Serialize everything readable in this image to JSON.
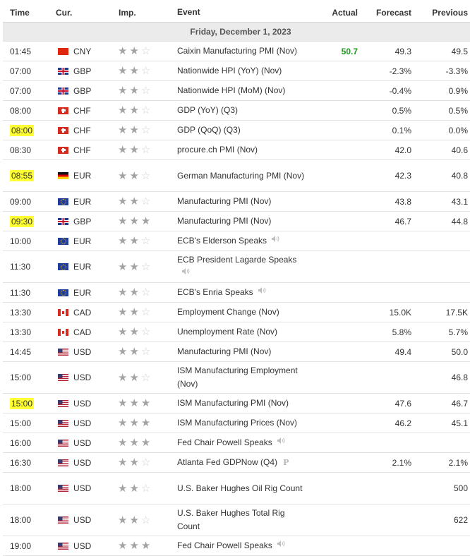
{
  "headers": {
    "time": "Time",
    "currency": "Cur.",
    "importance": "Imp.",
    "event": "Event",
    "actual": "Actual",
    "forecast": "Forecast",
    "previous": "Previous"
  },
  "date_label": "Friday, December 1, 2023",
  "colors": {
    "actual_better": "#1a9b1a",
    "highlight": "#ffff33",
    "star_on": "#a3a3a3",
    "star_off": "#d0d0d0"
  },
  "rows": [
    {
      "time": "01:45",
      "flag": "cny",
      "currency": "CNY",
      "stars": 2,
      "event": "Caixin Manufacturing PMI (Nov)",
      "actual": "50.7",
      "forecast": "49.3",
      "previous": "49.5",
      "highlight": false,
      "speaker": false,
      "prelim": false,
      "tall": false
    },
    {
      "time": "07:00",
      "flag": "gbp",
      "currency": "GBP",
      "stars": 2,
      "event": "Nationwide HPI (YoY) (Nov)",
      "actual": "",
      "forecast": "-2.3%",
      "previous": "-3.3%",
      "highlight": false,
      "speaker": false,
      "prelim": false,
      "tall": false
    },
    {
      "time": "07:00",
      "flag": "gbp",
      "currency": "GBP",
      "stars": 2,
      "event": "Nationwide HPI (MoM) (Nov)",
      "actual": "",
      "forecast": "-0.4%",
      "previous": "0.9%",
      "highlight": false,
      "speaker": false,
      "prelim": false,
      "tall": false
    },
    {
      "time": "08:00",
      "flag": "chf",
      "currency": "CHF",
      "stars": 2,
      "event": "GDP (YoY) (Q3)",
      "actual": "",
      "forecast": "0.5%",
      "previous": "0.5%",
      "highlight": false,
      "speaker": false,
      "prelim": false,
      "tall": false
    },
    {
      "time": "08:00",
      "flag": "chf",
      "currency": "CHF",
      "stars": 2,
      "event": "GDP (QoQ) (Q3)",
      "actual": "",
      "forecast": "0.1%",
      "previous": "0.0%",
      "highlight": true,
      "speaker": false,
      "prelim": false,
      "tall": false
    },
    {
      "time": "08:30",
      "flag": "chf",
      "currency": "CHF",
      "stars": 2,
      "event": "procure.ch PMI (Nov)",
      "actual": "",
      "forecast": "42.0",
      "previous": "40.6",
      "highlight": false,
      "speaker": false,
      "prelim": false,
      "tall": false
    },
    {
      "time": "08:55",
      "flag": "eur-de",
      "currency": "EUR",
      "stars": 2,
      "event": "German Manufacturing PMI (Nov)",
      "actual": "",
      "forecast": "42.3",
      "previous": "40.8",
      "highlight": true,
      "speaker": false,
      "prelim": false,
      "tall": true
    },
    {
      "time": "09:00",
      "flag": "eur",
      "currency": "EUR",
      "stars": 2,
      "event": "Manufacturing PMI (Nov)",
      "actual": "",
      "forecast": "43.8",
      "previous": "43.1",
      "highlight": false,
      "speaker": false,
      "prelim": false,
      "tall": false
    },
    {
      "time": "09:30",
      "flag": "gbp",
      "currency": "GBP",
      "stars": 3,
      "event": "Manufacturing PMI (Nov)",
      "actual": "",
      "forecast": "46.7",
      "previous": "44.8",
      "highlight": true,
      "speaker": false,
      "prelim": false,
      "tall": false
    },
    {
      "time": "10:00",
      "flag": "eur",
      "currency": "EUR",
      "stars": 2,
      "event": "ECB's Elderson Speaks",
      "actual": "",
      "forecast": "",
      "previous": "",
      "highlight": false,
      "speaker": true,
      "prelim": false,
      "tall": false
    },
    {
      "time": "11:30",
      "flag": "eur",
      "currency": "EUR",
      "stars": 2,
      "event": "ECB President Lagarde Speaks",
      "actual": "",
      "forecast": "",
      "previous": "",
      "highlight": false,
      "speaker": true,
      "prelim": false,
      "tall": true
    },
    {
      "time": "11:30",
      "flag": "eur",
      "currency": "EUR",
      "stars": 2,
      "event": "ECB's Enria Speaks",
      "actual": "",
      "forecast": "",
      "previous": "",
      "highlight": false,
      "speaker": true,
      "prelim": false,
      "tall": false
    },
    {
      "time": "13:30",
      "flag": "cad",
      "currency": "CAD",
      "stars": 2,
      "event": "Employment Change (Nov)",
      "actual": "",
      "forecast": "15.0K",
      "previous": "17.5K",
      "highlight": false,
      "speaker": false,
      "prelim": false,
      "tall": false
    },
    {
      "time": "13:30",
      "flag": "cad",
      "currency": "CAD",
      "stars": 2,
      "event": "Unemployment Rate (Nov)",
      "actual": "",
      "forecast": "5.8%",
      "previous": "5.7%",
      "highlight": false,
      "speaker": false,
      "prelim": false,
      "tall": false
    },
    {
      "time": "14:45",
      "flag": "usd",
      "currency": "USD",
      "stars": 2,
      "event": "Manufacturing PMI (Nov)",
      "actual": "",
      "forecast": "49.4",
      "previous": "50.0",
      "highlight": false,
      "speaker": false,
      "prelim": false,
      "tall": false
    },
    {
      "time": "15:00",
      "flag": "usd",
      "currency": "USD",
      "stars": 2,
      "event": "ISM Manufacturing Employment (Nov)",
      "actual": "",
      "forecast": "",
      "previous": "46.8",
      "highlight": false,
      "speaker": false,
      "prelim": false,
      "tall": true
    },
    {
      "time": "15:00",
      "flag": "usd",
      "currency": "USD",
      "stars": 3,
      "event": "ISM Manufacturing PMI (Nov)",
      "actual": "",
      "forecast": "47.6",
      "previous": "46.7",
      "highlight": true,
      "speaker": false,
      "prelim": false,
      "tall": false
    },
    {
      "time": "15:00",
      "flag": "usd",
      "currency": "USD",
      "stars": 3,
      "event": "ISM Manufacturing Prices (Nov)",
      "actual": "",
      "forecast": "46.2",
      "previous": "45.1",
      "highlight": false,
      "speaker": false,
      "prelim": false,
      "tall": false
    },
    {
      "time": "16:00",
      "flag": "usd",
      "currency": "USD",
      "stars": 3,
      "event": "Fed Chair Powell Speaks",
      "actual": "",
      "forecast": "",
      "previous": "",
      "highlight": false,
      "speaker": true,
      "prelim": false,
      "tall": false
    },
    {
      "time": "16:30",
      "flag": "usd",
      "currency": "USD",
      "stars": 2,
      "event": "Atlanta Fed GDPNow (Q4)",
      "actual": "",
      "forecast": "2.1%",
      "previous": "2.1%",
      "highlight": false,
      "speaker": false,
      "prelim": true,
      "tall": false
    },
    {
      "time": "18:00",
      "flag": "usd",
      "currency": "USD",
      "stars": 2,
      "event": "U.S. Baker Hughes Oil Rig Count",
      "actual": "",
      "forecast": "",
      "previous": "500",
      "highlight": false,
      "speaker": false,
      "prelim": false,
      "tall": true
    },
    {
      "time": "18:00",
      "flag": "usd",
      "currency": "USD",
      "stars": 2,
      "event": "U.S. Baker Hughes Total Rig Count",
      "actual": "",
      "forecast": "",
      "previous": "622",
      "highlight": false,
      "speaker": false,
      "prelim": false,
      "tall": true
    },
    {
      "time": "19:00",
      "flag": "usd",
      "currency": "USD",
      "stars": 3,
      "event": "Fed Chair Powell Speaks",
      "actual": "",
      "forecast": "",
      "previous": "",
      "highlight": false,
      "speaker": true,
      "prelim": false,
      "tall": false
    }
  ]
}
